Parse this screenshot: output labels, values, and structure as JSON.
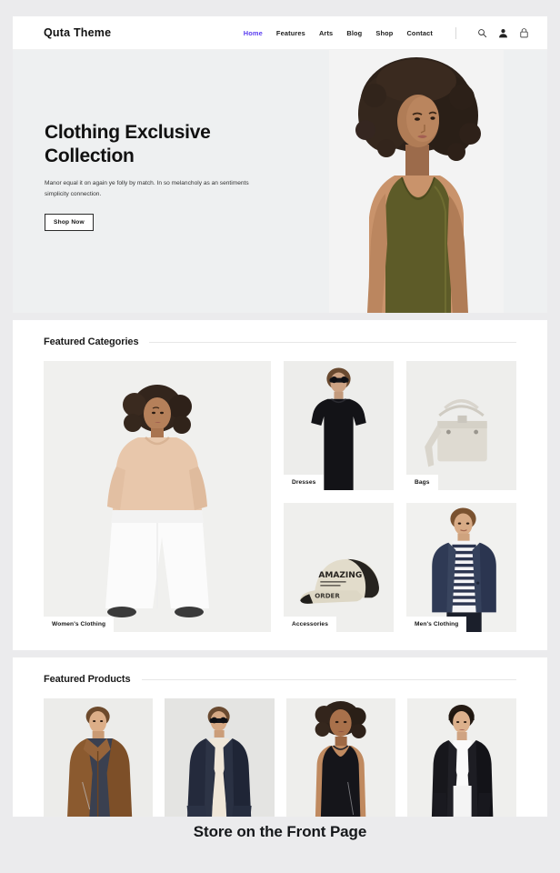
{
  "header": {
    "brand": "Quta Theme",
    "nav": [
      {
        "label": "Home",
        "active": true
      },
      {
        "label": "Features",
        "active": false
      },
      {
        "label": "Arts",
        "active": false
      },
      {
        "label": "Blog",
        "active": false
      },
      {
        "label": "Shop",
        "active": false
      },
      {
        "label": "Contact",
        "active": false
      }
    ],
    "icons": [
      "search-icon",
      "user-icon",
      "bag-icon"
    ],
    "active_color": "#5a3df0"
  },
  "hero": {
    "title_line1": "Clothing Exclusive",
    "title_line2": "Collection",
    "paragraph": "Manor equal it on again ye folly by match. In so melancholy as an sentiments simplicity connection.",
    "button": "Shop Now",
    "background": "#eef0f1",
    "image_alt": "woman-in-olive-tank-top"
  },
  "featured_categories": {
    "title": "Featured Categories",
    "items": [
      {
        "label": "Women's Clothing",
        "image_alt": "woman-in-beige-sweater-white-wide-pants"
      },
      {
        "label": "Dresses",
        "image_alt": "woman-in-black-puff-sleeve-dress-sunglasses"
      },
      {
        "label": "Bags",
        "image_alt": "cream-leather-handbag"
      },
      {
        "label": "Accessories",
        "image_alt": "beige-black-baseball-cap"
      },
      {
        "label": "Men's Clothing",
        "image_alt": "man-in-navy-blazer-striped-shirt"
      }
    ]
  },
  "featured_products": {
    "title": "Featured Products",
    "items": [
      {
        "image_alt": "man-in-brown-leather-jacket"
      },
      {
        "image_alt": "woman-in-navy-blazer-sunglasses"
      },
      {
        "image_alt": "woman-in-black-sleeveless-dress"
      },
      {
        "image_alt": "woman-in-black-cape-blazer"
      }
    ]
  },
  "caption": "Store on the Front Page"
}
